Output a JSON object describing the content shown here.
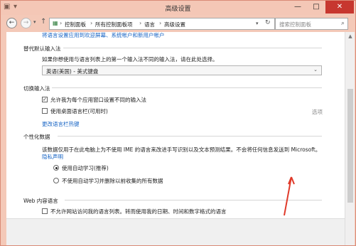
{
  "window": {
    "title": "高级设置"
  },
  "nav": {
    "breadcrumb": [
      "控制面板",
      "所有控制面板项",
      "语言",
      "高级设置"
    ],
    "search_placeholder": "搜索控制面板"
  },
  "top_link": "将语言设置应用到欢迎屏幕、系统帐户和新用户帐户",
  "override_input": {
    "heading": "替代默认输入法",
    "desc": "如果你想使用与语言列表上的第一个输入法不同的输入法，请在此处选择。",
    "selected": "英语(美国) - 美式键盘"
  },
  "switch_input": {
    "heading": "切换输入法",
    "opt_per_app": "允许我为每个应用窗口设置不同的输入法",
    "opt_per_app_checked": true,
    "opt_desktop_bar": "使用桌面语言栏(可用时)",
    "opt_desktop_bar_checked": false,
    "options_link": "选项",
    "hotkeys_link": "更改语言栏热键"
  },
  "personalization": {
    "heading": "个性化数据",
    "desc": "该数据仅用于在此电脑上为不使用 IME 的语言来改进手写识别以及文本预测结果。不会将任何信息发送到 Microsoft。",
    "privacy_link": "隐私声明",
    "radio_use": "使用自动学习(推荐)",
    "radio_use_selected": true,
    "radio_no": "不使用自动学习并删除以前收集的所有数据",
    "radio_no_selected": false
  },
  "web_language": {
    "heading": "Web 内容语言",
    "opt": "不允许网站访问我的语言列表。转而使用我的日期、时间和数字格式的语言",
    "opt_checked": false
  }
}
